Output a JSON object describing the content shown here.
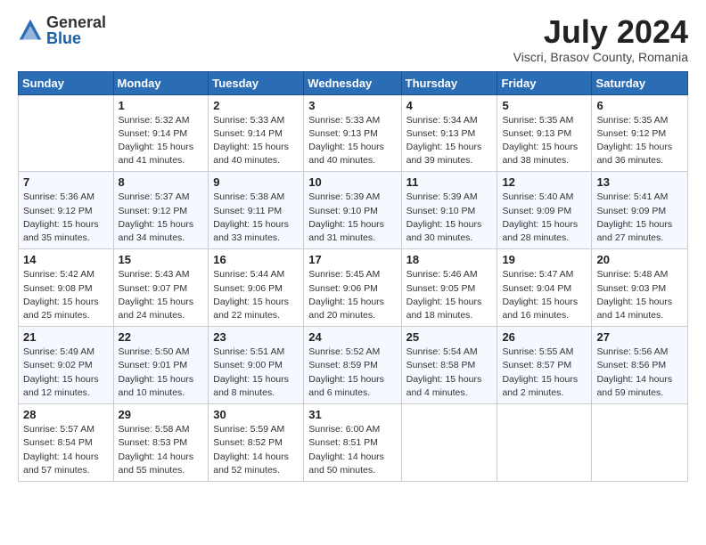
{
  "header": {
    "logo_general": "General",
    "logo_blue": "Blue",
    "month": "July 2024",
    "location": "Viscri, Brasov County, Romania"
  },
  "weekdays": [
    "Sunday",
    "Monday",
    "Tuesday",
    "Wednesday",
    "Thursday",
    "Friday",
    "Saturday"
  ],
  "weeks": [
    [
      {
        "day": "",
        "info": ""
      },
      {
        "day": "1",
        "info": "Sunrise: 5:32 AM\nSunset: 9:14 PM\nDaylight: 15 hours\nand 41 minutes."
      },
      {
        "day": "2",
        "info": "Sunrise: 5:33 AM\nSunset: 9:14 PM\nDaylight: 15 hours\nand 40 minutes."
      },
      {
        "day": "3",
        "info": "Sunrise: 5:33 AM\nSunset: 9:13 PM\nDaylight: 15 hours\nand 40 minutes."
      },
      {
        "day": "4",
        "info": "Sunrise: 5:34 AM\nSunset: 9:13 PM\nDaylight: 15 hours\nand 39 minutes."
      },
      {
        "day": "5",
        "info": "Sunrise: 5:35 AM\nSunset: 9:13 PM\nDaylight: 15 hours\nand 38 minutes."
      },
      {
        "day": "6",
        "info": "Sunrise: 5:35 AM\nSunset: 9:12 PM\nDaylight: 15 hours\nand 36 minutes."
      }
    ],
    [
      {
        "day": "7",
        "info": "Sunrise: 5:36 AM\nSunset: 9:12 PM\nDaylight: 15 hours\nand 35 minutes."
      },
      {
        "day": "8",
        "info": "Sunrise: 5:37 AM\nSunset: 9:12 PM\nDaylight: 15 hours\nand 34 minutes."
      },
      {
        "day": "9",
        "info": "Sunrise: 5:38 AM\nSunset: 9:11 PM\nDaylight: 15 hours\nand 33 minutes."
      },
      {
        "day": "10",
        "info": "Sunrise: 5:39 AM\nSunset: 9:10 PM\nDaylight: 15 hours\nand 31 minutes."
      },
      {
        "day": "11",
        "info": "Sunrise: 5:39 AM\nSunset: 9:10 PM\nDaylight: 15 hours\nand 30 minutes."
      },
      {
        "day": "12",
        "info": "Sunrise: 5:40 AM\nSunset: 9:09 PM\nDaylight: 15 hours\nand 28 minutes."
      },
      {
        "day": "13",
        "info": "Sunrise: 5:41 AM\nSunset: 9:09 PM\nDaylight: 15 hours\nand 27 minutes."
      }
    ],
    [
      {
        "day": "14",
        "info": "Sunrise: 5:42 AM\nSunset: 9:08 PM\nDaylight: 15 hours\nand 25 minutes."
      },
      {
        "day": "15",
        "info": "Sunrise: 5:43 AM\nSunset: 9:07 PM\nDaylight: 15 hours\nand 24 minutes."
      },
      {
        "day": "16",
        "info": "Sunrise: 5:44 AM\nSunset: 9:06 PM\nDaylight: 15 hours\nand 22 minutes."
      },
      {
        "day": "17",
        "info": "Sunrise: 5:45 AM\nSunset: 9:06 PM\nDaylight: 15 hours\nand 20 minutes."
      },
      {
        "day": "18",
        "info": "Sunrise: 5:46 AM\nSunset: 9:05 PM\nDaylight: 15 hours\nand 18 minutes."
      },
      {
        "day": "19",
        "info": "Sunrise: 5:47 AM\nSunset: 9:04 PM\nDaylight: 15 hours\nand 16 minutes."
      },
      {
        "day": "20",
        "info": "Sunrise: 5:48 AM\nSunset: 9:03 PM\nDaylight: 15 hours\nand 14 minutes."
      }
    ],
    [
      {
        "day": "21",
        "info": "Sunrise: 5:49 AM\nSunset: 9:02 PM\nDaylight: 15 hours\nand 12 minutes."
      },
      {
        "day": "22",
        "info": "Sunrise: 5:50 AM\nSunset: 9:01 PM\nDaylight: 15 hours\nand 10 minutes."
      },
      {
        "day": "23",
        "info": "Sunrise: 5:51 AM\nSunset: 9:00 PM\nDaylight: 15 hours\nand 8 minutes."
      },
      {
        "day": "24",
        "info": "Sunrise: 5:52 AM\nSunset: 8:59 PM\nDaylight: 15 hours\nand 6 minutes."
      },
      {
        "day": "25",
        "info": "Sunrise: 5:54 AM\nSunset: 8:58 PM\nDaylight: 15 hours\nand 4 minutes."
      },
      {
        "day": "26",
        "info": "Sunrise: 5:55 AM\nSunset: 8:57 PM\nDaylight: 15 hours\nand 2 minutes."
      },
      {
        "day": "27",
        "info": "Sunrise: 5:56 AM\nSunset: 8:56 PM\nDaylight: 14 hours\nand 59 minutes."
      }
    ],
    [
      {
        "day": "28",
        "info": "Sunrise: 5:57 AM\nSunset: 8:54 PM\nDaylight: 14 hours\nand 57 minutes."
      },
      {
        "day": "29",
        "info": "Sunrise: 5:58 AM\nSunset: 8:53 PM\nDaylight: 14 hours\nand 55 minutes."
      },
      {
        "day": "30",
        "info": "Sunrise: 5:59 AM\nSunset: 8:52 PM\nDaylight: 14 hours\nand 52 minutes."
      },
      {
        "day": "31",
        "info": "Sunrise: 6:00 AM\nSunset: 8:51 PM\nDaylight: 14 hours\nand 50 minutes."
      },
      {
        "day": "",
        "info": ""
      },
      {
        "day": "",
        "info": ""
      },
      {
        "day": "",
        "info": ""
      }
    ]
  ]
}
